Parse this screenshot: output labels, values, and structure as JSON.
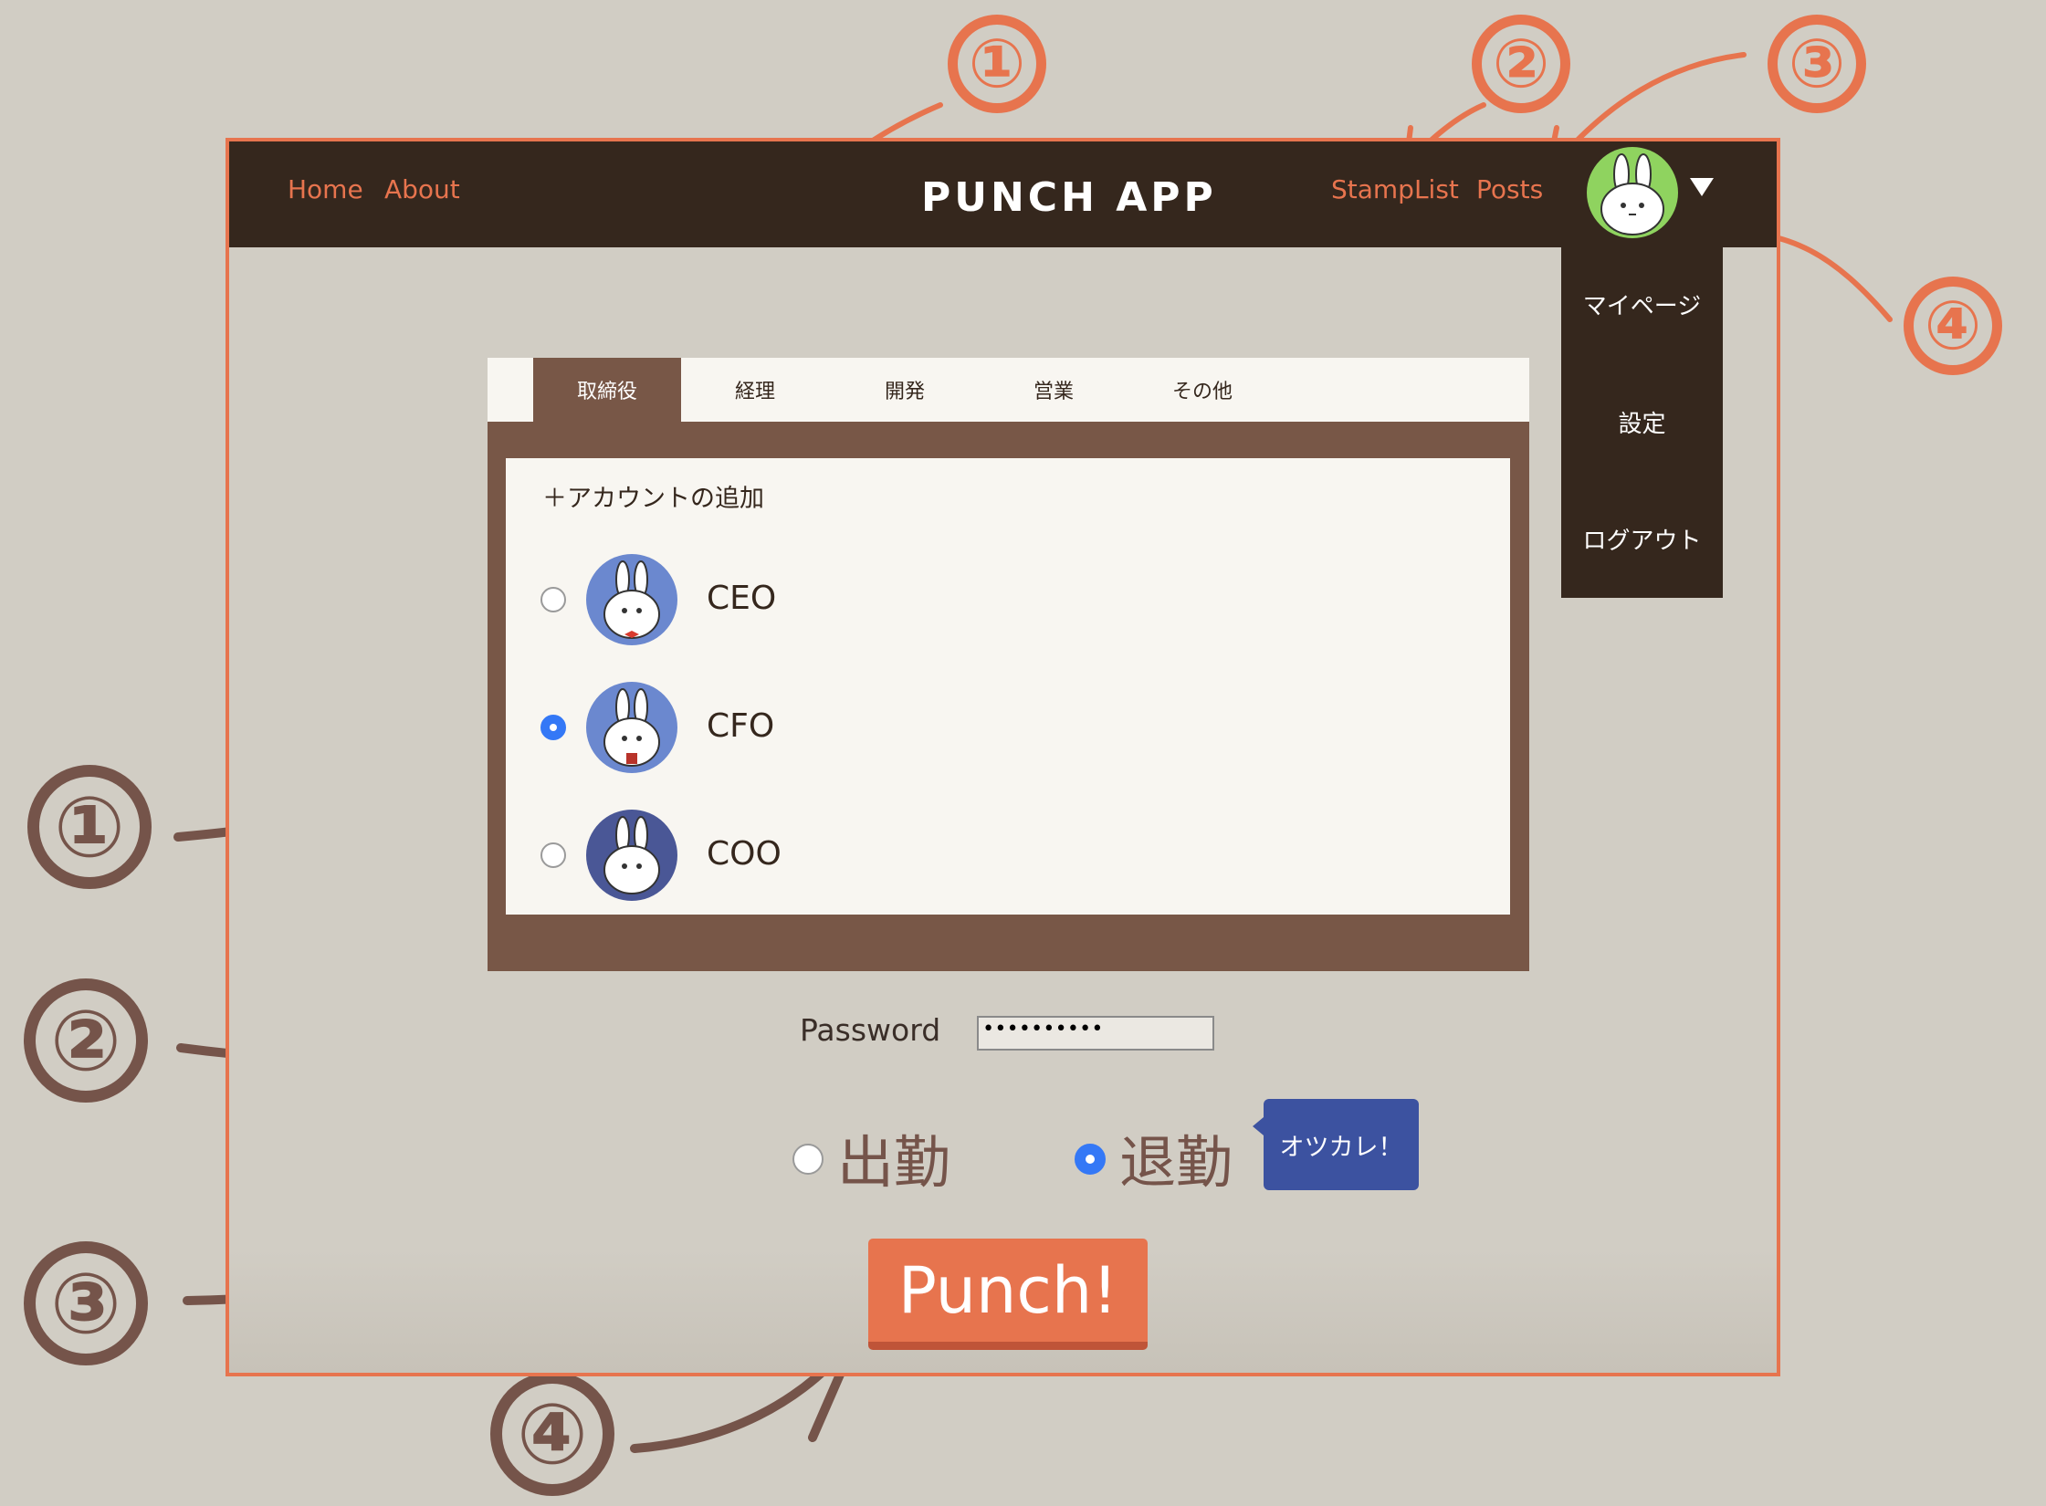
{
  "nav": {
    "home": "Home",
    "about": "About",
    "brand": "PUNCH APP",
    "stamplist": "StampList",
    "posts": "Posts"
  },
  "user_menu": {
    "items": [
      "マイページ",
      "設定",
      "ログアウト"
    ]
  },
  "tabs": [
    {
      "label": "取締役",
      "active": true
    },
    {
      "label": "経理",
      "active": false
    },
    {
      "label": "開発",
      "active": false
    },
    {
      "label": "営業",
      "active": false
    },
    {
      "label": "その他",
      "active": false
    }
  ],
  "accounts": {
    "add_label": "＋アカウントの追加",
    "items": [
      {
        "name": "CEO",
        "selected": false,
        "avatar_color": "#6b88cf"
      },
      {
        "name": "CFO",
        "selected": true,
        "avatar_color": "#6b88cf"
      },
      {
        "name": "COO",
        "selected": false,
        "avatar_color": "#4a5796"
      }
    ]
  },
  "password": {
    "label": "Password",
    "value": "••••••••••"
  },
  "punch": {
    "options": [
      {
        "label": "出勤",
        "selected": false
      },
      {
        "label": "退勤",
        "selected": true
      }
    ],
    "tooltip": "オツカレ！",
    "button": "Punch!"
  },
  "annotations": {
    "top": [
      "①",
      "②",
      "③",
      "④"
    ],
    "left": [
      "①",
      "②",
      "③",
      "④"
    ]
  },
  "colors": {
    "accent": "#e7744e",
    "navbar": "#35271d",
    "panel": "#785747",
    "annotation_brown": "#75544a",
    "background": "#d1cdc4",
    "radio_checked": "#3478f6",
    "tooltip": "#3c52a0",
    "user_avatar": "#8fd35f"
  }
}
